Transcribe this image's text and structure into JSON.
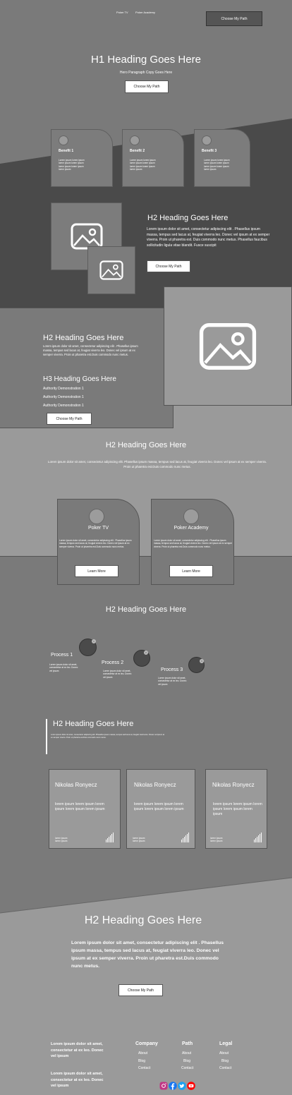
{
  "nav": {
    "links": [
      "Poker TV",
      "Poker Academy"
    ],
    "cta": "Choose My Path"
  },
  "hero": {
    "title": "H1 Heading Goes Here",
    "subtitle": "Hero Paragraph Copy Goes Here",
    "button": "Choose My Path"
  },
  "benefits": [
    {
      "title": "Benefit 1",
      "text": "Lorem ipsum lorem ipsum lorem ipsum lorem ipsum lorem ipsum lorem ipsum lorem ipsum"
    },
    {
      "title": "Benefit 2",
      "text": "Lorem ipsum lorem ipsum lorem ipsum lorem ipsum lorem ipsum lorem ipsum lorem ipsum"
    },
    {
      "title": "Benefit 3",
      "text": "Lorem ipsum lorem ipsum lorem ipsum lorem ipsum lorem ipsum lorem ipsum lorem ipsum"
    }
  ],
  "feature1": {
    "title": "H2 Heading Goes Here",
    "text": "Lorem ipsum dolor sit amet, consectetur adipiscing elit . Phasellus ipsum massa, tempus sed lacus at, feugiat viverra leo. Donec vel ipsum at ex semper viverra. Proin ut pharetra est. Duis commodo nunc metus. Phasellus faucibus sollicitudin ligula vitae blandit. Fusce suscipit",
    "button": "Choose My Path"
  },
  "authority": {
    "title": "H2 Heading Goes Here",
    "text": "Lorem ipsum dolor sit amet, consectetur adipiscing elit . Phasellus ipsum massa, tempus sed lacus at, feugiat viverra leo. Donec vel ipsum at ex semper viverra. Proin ut pharetra est.Duis commodo nunc metus.",
    "subtitle": "H3 Heading Goes Here",
    "items": [
      "Authority Demonstration 1",
      "Authority Demonstration 1",
      "Authority Demonstration 1"
    ],
    "button": "Choose My Path"
  },
  "paths": {
    "title": "H2 Heading Goes Here",
    "text": "Lorem ipsum dolor sit amet, consectetur adipiscing elit. Phasellus ipsum massa, tempus sed lacus at, feugiat viverra leo. Donec vel ipsum at ex semper viverra. Proin ut pharetra est.Duis commodo nunc metus.",
    "cards": [
      {
        "title": "Poker TV",
        "text": "Lorem ipsum dolor sit amet, consectetur adipiscing elit . Phasellus ipsum massa, tempus sed lacus at, feugiat viverra leo. Donec vel ipsum at ex semper viverra. Proin ut pharetra est.Duis commodo nunc metus.",
        "button": "Learn More"
      },
      {
        "title": "Poker Academy",
        "text": "Lorem ipsum dolor sit amet, consectetur adipiscing elit . Phasellus ipsum massa, tempus sed lacus at, feugiat viverra leo. Donec vel ipsum at ex semper viverra. Proin ut pharetra est.Duis commodo nunc metus.",
        "button": "Learn More"
      }
    ]
  },
  "process": {
    "title": "H2 Heading Goes Here",
    "steps": [
      {
        "title": "Process 1",
        "text": "Lorem ipsum dolor sit amet, consectetur at ex leo. Donec vel ipsum",
        "num": "1"
      },
      {
        "title": "Process 2",
        "text": "Lorem ipsum dolor sit amet, consectetur at ex leo. Donec vel ipsum",
        "num": "2"
      },
      {
        "title": "Process 3",
        "text": "Lorem ipsum dolor sit amet, consectetur at ex leo. Donec vel ipsum",
        "num": "3"
      }
    ]
  },
  "quote": {
    "title": "H2 Heading Goes Here",
    "text": "Lorem ipsum dolor sit amet, consectetur adipiscing elit. Phasellus ipsum massa, tempus sed lacus at, feugiat viverra leo. Donec vel ipsum at ex semper viverra. Proin ut pharetra est.Duis commodo nunc metus."
  },
  "testimonials": [
    {
      "name": "Nikolas Ronyecz",
      "text": "lorem ipsum lorem ipsum lorem ipsum lorem ipsum lorem ipsum",
      "footer": [
        "lorem ipsum",
        "lorem ipsum"
      ]
    },
    {
      "name": "Nikolas Ronyecz",
      "text": "lorem ipsum lorem ipsum lorem ipsum lorem ipsum lorem ipsum",
      "footer": [
        "lorem ipsum",
        "lorem ipsum"
      ]
    },
    {
      "name": "Nikolas Ronyecz",
      "text": "lorem ipsum lorem ipsum lorem ipsum lorem ipsum lorem ipsum",
      "footer": [
        "lorem ipsum",
        "lorem ipsum"
      ]
    }
  ],
  "cta": {
    "title": "H2 Heading Goes Here",
    "text": "Lorem ipsum dolor sit amet, consectetur adipiscing elit . Phasellus ipsum massa, tempus sed lacus at, feugiat viverra leo. Donec vel ipsum at ex semper viverra. Proin ut pharetra est.Duis commodo nunc metus.",
    "button": "Choose My Path"
  },
  "footer": {
    "about1": "Lorem ipsum dolor sit amet, consectetur at ex leo. Donec vel ipsum",
    "about2": "Lorem ipsum dolor sit amet, consectetur at ex leo. Donec vel ipsum",
    "columns": [
      {
        "title": "Company",
        "links": [
          "About",
          "Blog",
          "Contact"
        ]
      },
      {
        "title": "Path",
        "links": [
          "About",
          "Blog",
          "Contact"
        ]
      },
      {
        "title": "Legal",
        "links": [
          "About",
          "Blog",
          "Contact"
        ]
      }
    ],
    "social": [
      "instagram-icon",
      "facebook-icon",
      "twitter-icon",
      "youtube-icon"
    ]
  },
  "colors": {
    "dark": "#4a4a4a",
    "mid": "#7a7a7a",
    "light": "#9a9a9a",
    "instagram": "#c13584",
    "facebook": "#1877f2",
    "twitter": "#1da1f2",
    "youtube": "#ff0000"
  }
}
